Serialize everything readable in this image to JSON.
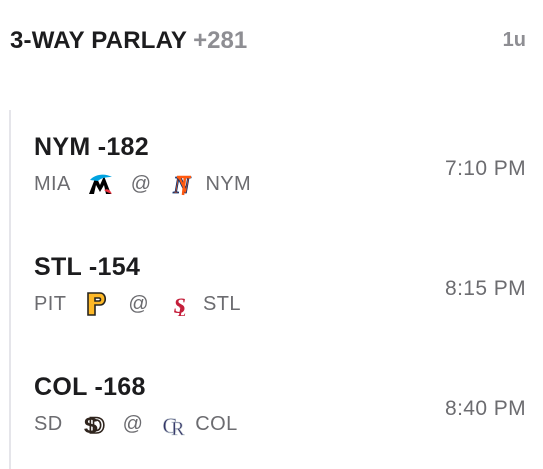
{
  "parlay": {
    "title": "3-WAY PARLAY",
    "odds": "+281",
    "units": "1u"
  },
  "legs": [
    {
      "pick": "NYM -182",
      "away": "MIA",
      "at": "@",
      "home": "NYM",
      "time": "7:10 PM",
      "away_logo": "marlins-logo",
      "home_logo": "mets-logo"
    },
    {
      "pick": "STL -154",
      "away": "PIT",
      "at": "@",
      "home": "STL",
      "time": "8:15 PM",
      "away_logo": "pirates-logo",
      "home_logo": "cardinals-logo"
    },
    {
      "pick": "COL -168",
      "away": "SD",
      "at": "@",
      "home": "COL",
      "time": "8:40 PM",
      "away_logo": "padres-logo",
      "home_logo": "rockies-logo"
    }
  ],
  "colors": {
    "text_primary": "#1c1c1e",
    "text_secondary": "#6c6c70",
    "muted": "#8e8e93",
    "rail": "#e5e5ea",
    "marlins": "#00a3e0",
    "mets": "#ff5910",
    "pirates": "#fdb827",
    "cardinals": "#c41e3a",
    "padres": "#2f241d",
    "rockies": "#333366"
  }
}
